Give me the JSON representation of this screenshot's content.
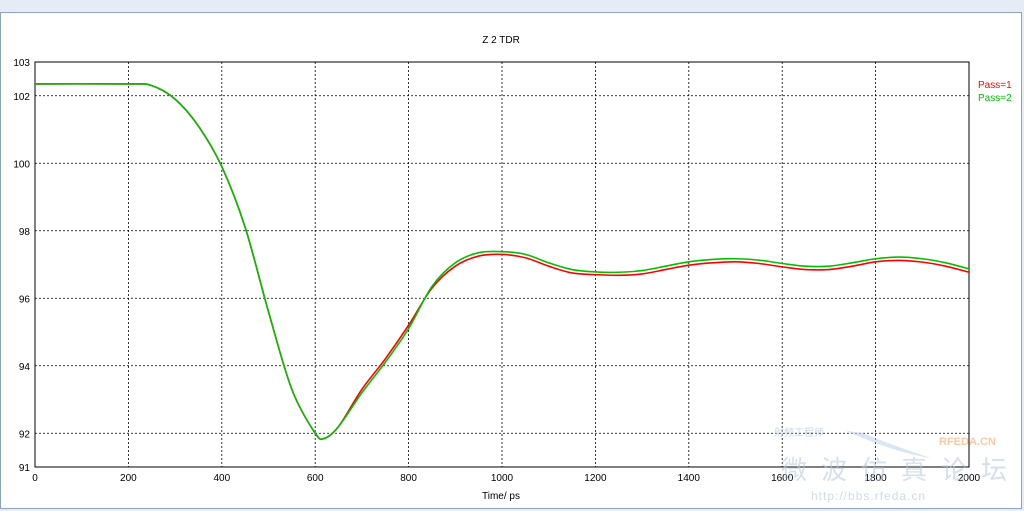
{
  "chart_data": {
    "type": "line",
    "title": "Z 2 TDR",
    "xlabel": "Time/ ps",
    "ylabel": "",
    "xlim": [
      0,
      2000
    ],
    "ylim": [
      91,
      103
    ],
    "xticks": [
      0,
      200,
      400,
      600,
      800,
      1000,
      1200,
      1400,
      1600,
      1800,
      2000
    ],
    "yticks": [
      91,
      92,
      94,
      96,
      98,
      100,
      102,
      103
    ],
    "grid": true,
    "legend_position": "top-right",
    "series": [
      {
        "name": "Pass=1",
        "color": "#ff0000",
        "x": [
          0,
          200,
          250,
          300,
          350,
          400,
          450,
          500,
          550,
          600,
          620,
          650,
          700,
          750,
          800,
          850,
          900,
          950,
          1000,
          1050,
          1100,
          1150,
          1200,
          1250,
          1300,
          1350,
          1400,
          1450,
          1500,
          1550,
          1600,
          1650,
          1700,
          1750,
          1800,
          1850,
          1900,
          1950,
          2000
        ],
        "y": [
          102.35,
          102.35,
          102.3,
          101.9,
          101.1,
          99.9,
          98.1,
          95.6,
          93.3,
          92.0,
          91.85,
          92.2,
          93.3,
          94.2,
          95.2,
          96.3,
          96.95,
          97.25,
          97.3,
          97.2,
          96.95,
          96.75,
          96.7,
          96.68,
          96.72,
          96.85,
          96.98,
          97.05,
          97.08,
          97.03,
          96.93,
          96.85,
          96.85,
          96.95,
          97.08,
          97.12,
          97.07,
          96.95,
          96.77
        ]
      },
      {
        "name": "Pass=2",
        "color": "#00c000",
        "x": [
          0,
          200,
          250,
          300,
          350,
          400,
          450,
          500,
          550,
          600,
          620,
          650,
          700,
          750,
          800,
          850,
          900,
          950,
          1000,
          1050,
          1100,
          1150,
          1200,
          1250,
          1300,
          1350,
          1400,
          1450,
          1500,
          1550,
          1600,
          1650,
          1700,
          1750,
          1800,
          1850,
          1900,
          1950,
          2000
        ],
        "y": [
          102.35,
          102.35,
          102.3,
          101.9,
          101.1,
          99.9,
          98.1,
          95.6,
          93.3,
          92.0,
          91.85,
          92.2,
          93.2,
          94.1,
          95.1,
          96.35,
          97.05,
          97.35,
          97.38,
          97.3,
          97.05,
          96.85,
          96.78,
          96.77,
          96.82,
          96.95,
          97.08,
          97.15,
          97.17,
          97.13,
          97.03,
          96.95,
          96.95,
          97.05,
          97.17,
          97.22,
          97.17,
          97.05,
          96.87
        ]
      }
    ]
  },
  "watermark": {
    "site": "RFEDA.CN",
    "cn_title": "微波仿真论坛",
    "cn_small": "射频工程师",
    "url": "http://bbs.rfeda.cn"
  }
}
